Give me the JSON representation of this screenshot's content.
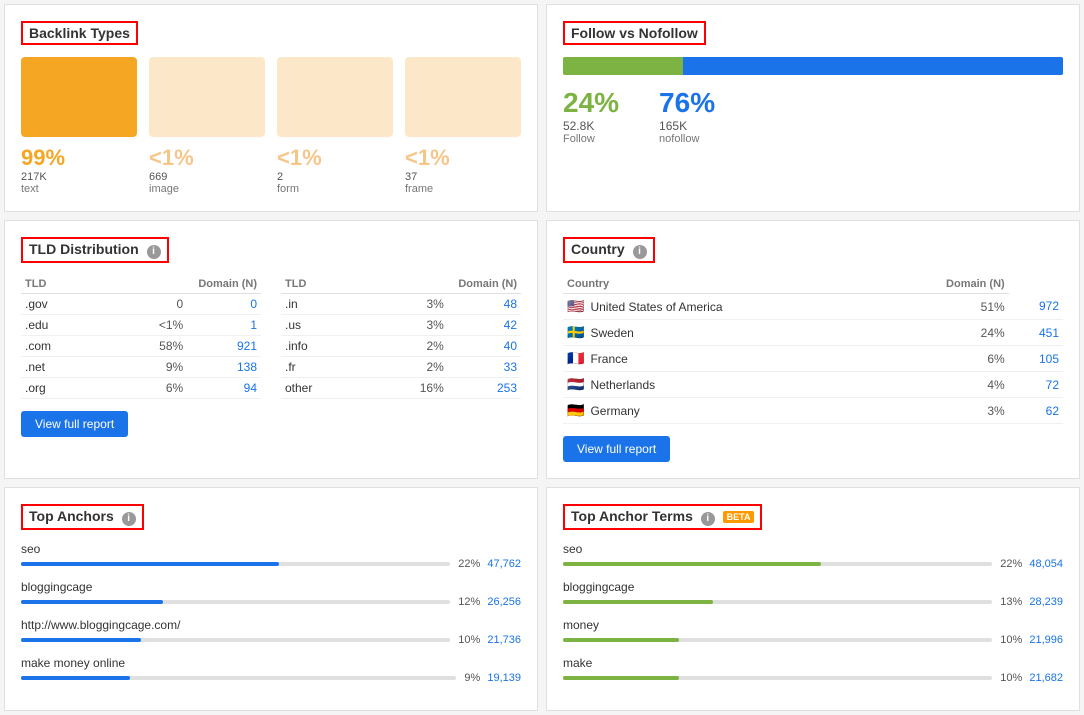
{
  "backlink_types": {
    "title": "Backlink Types",
    "items": [
      {
        "pct": "99%",
        "count": "217K",
        "type": "text",
        "color": "#f5a623",
        "box_color": "#f5a623"
      },
      {
        "pct": "<1%",
        "count": "669",
        "type": "image",
        "color": "#f5c68a",
        "box_color": "#fce8c8"
      },
      {
        "pct": "<1%",
        "count": "2",
        "type": "form",
        "color": "#f5c68a",
        "box_color": "#fce8c8"
      },
      {
        "pct": "<1%",
        "count": "37",
        "type": "frame",
        "color": "#f5c68a",
        "box_color": "#fce8c8"
      }
    ]
  },
  "follow_vs_nofollow": {
    "title": "Follow vs Nofollow",
    "follow_pct": "24%",
    "nofollow_pct": "76%",
    "follow_count": "52.8K",
    "nofollow_count": "165K",
    "follow_label": "Follow",
    "nofollow_label": "nofollow",
    "follow_bar_width": "24%"
  },
  "tld_distribution": {
    "title": "TLD Distribution",
    "col1_headers": [
      "TLD",
      "Domain (N)"
    ],
    "col2_headers": [
      "TLD",
      "Domain (N)"
    ],
    "col1_rows": [
      {
        "tld": ".gov",
        "pct": "0",
        "count": "0"
      },
      {
        "tld": ".edu",
        "pct": "<1%",
        "count": "1"
      },
      {
        "tld": ".com",
        "pct": "58%",
        "count": "921"
      },
      {
        "tld": ".net",
        "pct": "9%",
        "count": "138"
      },
      {
        "tld": ".org",
        "pct": "6%",
        "count": "94"
      }
    ],
    "col2_rows": [
      {
        "tld": ".in",
        "pct": "3%",
        "count": "48"
      },
      {
        "tld": ".us",
        "pct": "3%",
        "count": "42"
      },
      {
        "tld": ".info",
        "pct": "2%",
        "count": "40"
      },
      {
        "tld": ".fr",
        "pct": "2%",
        "count": "33"
      },
      {
        "tld": "other",
        "pct": "16%",
        "count": "253"
      }
    ],
    "view_report_label": "View full report"
  },
  "country": {
    "title": "Country",
    "headers": [
      "Country",
      "Domain (N)"
    ],
    "rows": [
      {
        "flag": "🇺🇸",
        "name": "United States of America",
        "pct": "51%",
        "count": "972"
      },
      {
        "flag": "🇸🇪",
        "name": "Sweden",
        "pct": "24%",
        "count": "451"
      },
      {
        "flag": "🇫🇷",
        "name": "France",
        "pct": "6%",
        "count": "105"
      },
      {
        "flag": "🇳🇱",
        "name": "Netherlands",
        "pct": "4%",
        "count": "72"
      },
      {
        "flag": "🇩🇪",
        "name": "Germany",
        "pct": "3%",
        "count": "62"
      }
    ],
    "view_report_label": "View full report"
  },
  "top_anchors": {
    "title": "Top Anchors",
    "items": [
      {
        "label": "seo",
        "pct": "22%",
        "count": "47,762",
        "bar_width": "60%"
      },
      {
        "label": "bloggingcage",
        "pct": "12%",
        "count": "26,256",
        "bar_width": "33%"
      },
      {
        "label": "http://www.bloggingcage.com/",
        "pct": "10%",
        "count": "21,736",
        "bar_width": "28%"
      },
      {
        "label": "make money online",
        "pct": "9%",
        "count": "19,139",
        "bar_width": "25%"
      }
    ]
  },
  "top_anchor_terms": {
    "title": "Top Anchor Terms",
    "beta": "BETA",
    "items": [
      {
        "label": "seo",
        "pct": "22%",
        "count": "48,054",
        "bar_width": "60%"
      },
      {
        "label": "bloggingcage",
        "pct": "13%",
        "count": "28,239",
        "bar_width": "35%"
      },
      {
        "label": "money",
        "pct": "10%",
        "count": "21,996",
        "bar_width": "27%"
      },
      {
        "label": "make",
        "pct": "10%",
        "count": "21,682",
        "bar_width": "27%"
      }
    ]
  }
}
